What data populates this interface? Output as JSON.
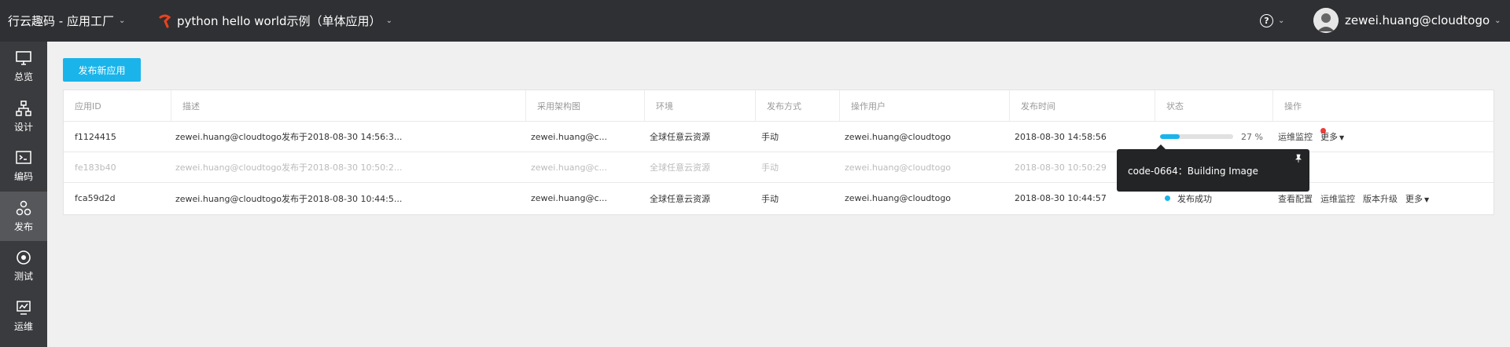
{
  "topbar": {
    "brand": "行云趣码 - 应用工厂",
    "project": "python hello world示例（单体应用）",
    "help_glyph": "?",
    "username": "zewei.huang@cloudtogo"
  },
  "sidebar": {
    "items": [
      {
        "label": "总览",
        "icon": "monitor-icon"
      },
      {
        "label": "设计",
        "icon": "diagram-icon"
      },
      {
        "label": "编码",
        "icon": "code-icon"
      },
      {
        "label": "发布",
        "icon": "publish-icon",
        "active": true
      },
      {
        "label": "测试",
        "icon": "target-icon"
      },
      {
        "label": "运维",
        "icon": "ops-icon"
      }
    ]
  },
  "main": {
    "publish_button": "发布新应用",
    "table": {
      "headers": [
        "应用ID",
        "描述",
        "采用架构图",
        "环境",
        "发布方式",
        "操作用户",
        "发布时间",
        "状态",
        "操作"
      ],
      "rows": [
        {
          "id": "f1124415",
          "desc": "zewei.huang@cloudtogo发布于2018-08-30 14:56:3...",
          "arch": "zewei.huang@c...",
          "env": "全球任意云资源",
          "method": "手动",
          "user": "zewei.huang@cloudtogo",
          "time": "2018-08-30 14:58:56",
          "progress": 0.27,
          "progress_text": "27 %",
          "ops": [
            "运维监控",
            "更多"
          ]
        },
        {
          "id": "fe183b40",
          "desc": "zewei.huang@cloudtogo发布于2018-08-30 10:50:2...",
          "arch": "zewei.huang@c...",
          "env": "全球任意云资源",
          "method": "手动",
          "user": "zewei.huang@cloudtogo",
          "time": "2018-08-30 10:50:29"
        },
        {
          "id": "fca59d2d",
          "desc": "zewei.huang@cloudtogo发布于2018-08-30 10:44:5...",
          "arch": "zewei.huang@c...",
          "env": "全球任意云资源",
          "method": "手动",
          "user": "zewei.huang@cloudtogo",
          "time": "2018-08-30 10:44:57",
          "status": "发布成功",
          "ops": [
            "查看配置",
            "运维监控",
            "版本升级",
            "更多"
          ]
        }
      ]
    },
    "tooltip": "code-0664：Building Image"
  },
  "colors": {
    "topbar": "#2f3033",
    "sidebar": "#3a3b3e",
    "sidebar_active": "#55575b",
    "accent": "#1ab4ea",
    "alert": "#ef3b3b"
  }
}
